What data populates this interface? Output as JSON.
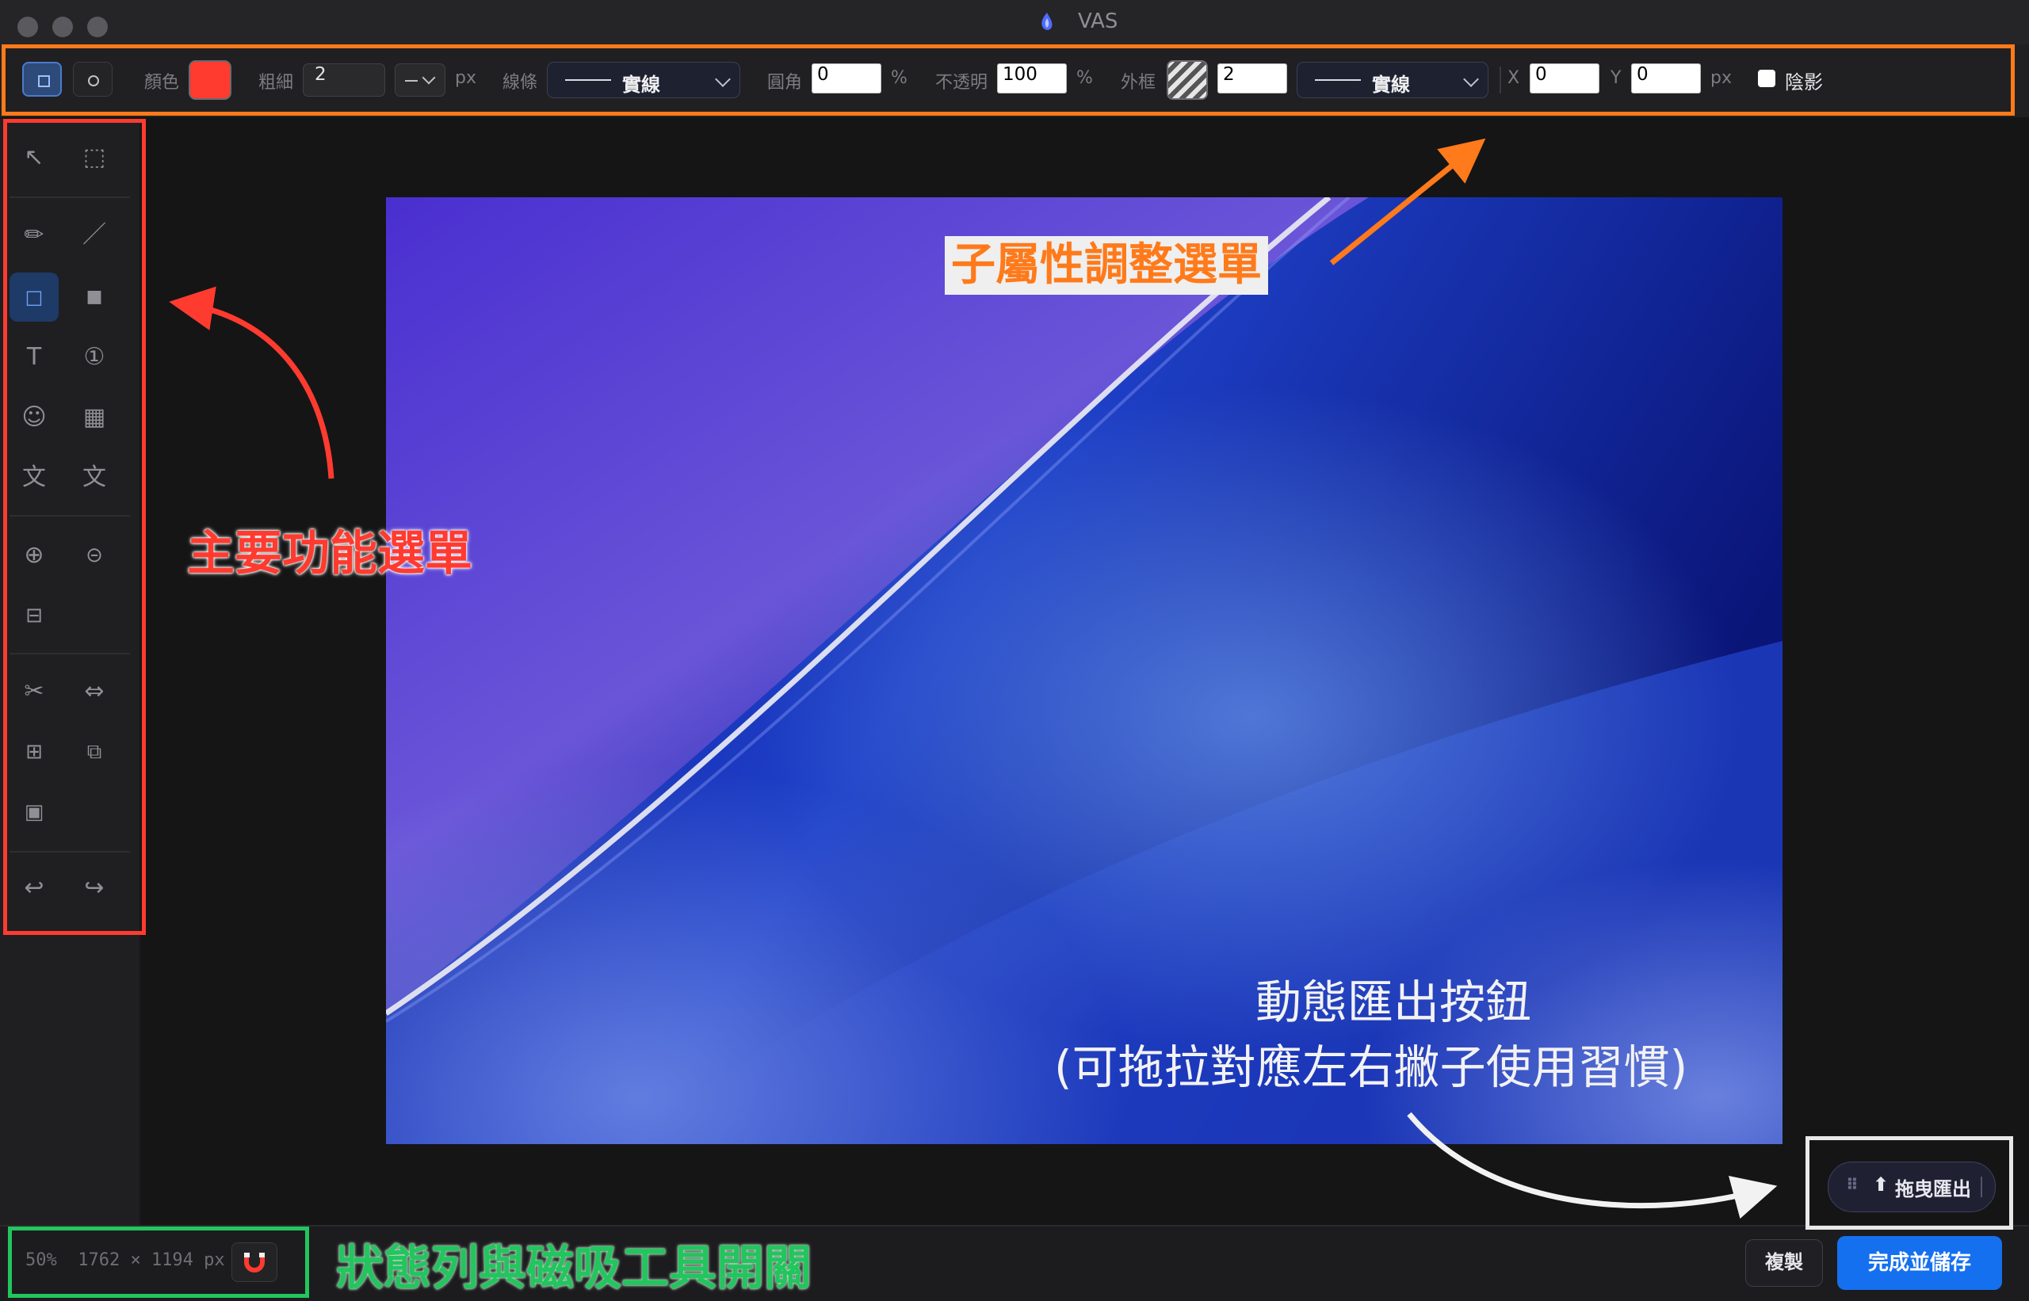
{
  "window": {
    "title": "VAS"
  },
  "toolbar": {
    "color_label": "顏色",
    "color_value": "#ff3b30",
    "width_label": "粗細",
    "width_value": "2",
    "width_unit": "px",
    "line_label": "線條",
    "line_style": "實線",
    "radius_label": "圓角",
    "radius_value": "0",
    "radius_unit": "%",
    "opacity_label": "不透明",
    "opacity_value": "100",
    "opacity_unit": "%",
    "border_label": "外框",
    "border_width_value": "2",
    "border_style": "實線",
    "x_label": "X",
    "x_value": "0",
    "y_label": "Y",
    "y_value": "0",
    "xy_unit": "px",
    "shadow_label": "陰影",
    "shadow_checked": false
  },
  "sidebar": {
    "tools": [
      {
        "name": "select-arrow-icon",
        "glyph": "↖"
      },
      {
        "name": "marquee-select-icon",
        "glyph": "⬚"
      },
      {
        "name": "pencil-icon",
        "glyph": "✏"
      },
      {
        "name": "line-icon",
        "glyph": "／"
      },
      {
        "name": "rectangle-outline-icon",
        "glyph": "□",
        "active": true
      },
      {
        "name": "rectangle-filled-icon",
        "glyph": "■"
      },
      {
        "name": "text-icon",
        "glyph": "T"
      },
      {
        "name": "number-marker-icon",
        "glyph": "①"
      },
      {
        "name": "emoji-icon",
        "glyph": "☺"
      },
      {
        "name": "mosaic-icon",
        "glyph": "▦"
      },
      {
        "name": "ocr-text-icon",
        "glyph": "文"
      },
      {
        "name": "translate-icon",
        "glyph": "⽂"
      },
      {
        "name": "zoom-in-icon",
        "glyph": "⊕"
      },
      {
        "name": "zoom-out-icon",
        "glyph": "⊝"
      },
      {
        "name": "fit-icon",
        "glyph": "⊟"
      },
      {
        "name": "crop-scissors-icon",
        "glyph": "✂"
      },
      {
        "name": "flip-icon",
        "glyph": "⇔"
      },
      {
        "name": "grid-icon",
        "glyph": "⊞"
      },
      {
        "name": "layer-copy-icon",
        "glyph": "⧉"
      },
      {
        "name": "frame-icon",
        "glyph": "▣"
      },
      {
        "name": "undo-icon",
        "glyph": "↩"
      },
      {
        "name": "redo-icon",
        "glyph": "↪"
      }
    ]
  },
  "status": {
    "text": "50%  1762 × 1194 px"
  },
  "buttons": {
    "copy": "複製",
    "save": "完成並儲存",
    "export": "拖曳匯出"
  },
  "annotations": {
    "submenu": "子屬性調整選單",
    "main_menu": "主要功能選單",
    "export_line1": "動態匯出按鈕",
    "export_line2": "(可拖拉對應左右撇子使用習慣)",
    "statusbar": "狀態列與磁吸工具開關"
  },
  "colors": {
    "accent_blue": "#1570ef",
    "annotation_orange": "#ff7a1a",
    "annotation_red": "#ff3b30",
    "annotation_green": "#22c55e",
    "annotation_white": "#e9e9e9"
  }
}
